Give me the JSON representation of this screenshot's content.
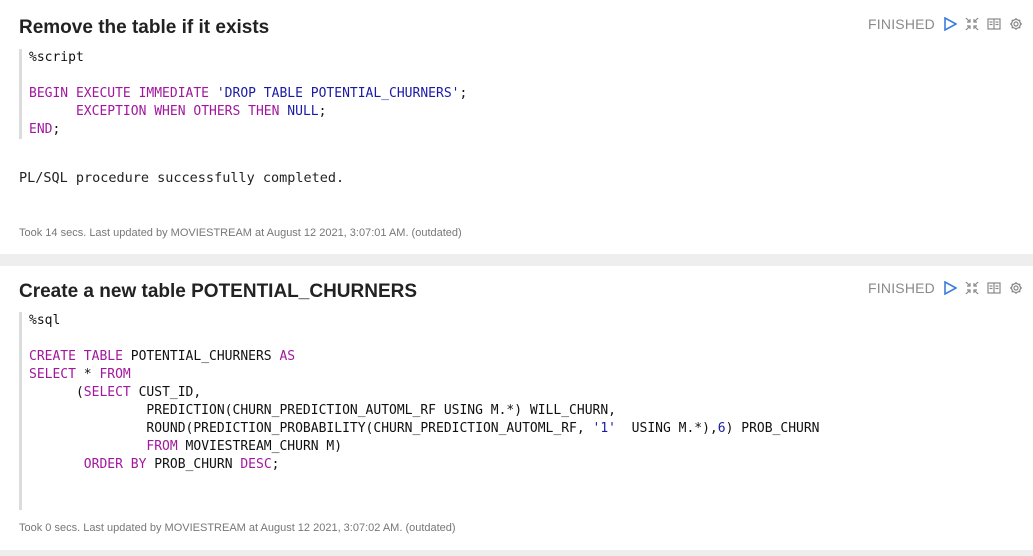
{
  "paragraph1": {
    "title": "Remove the table if it exists",
    "status": "FINISHED",
    "code_lines": [
      [
        {
          "t": "%script",
          "c": ""
        }
      ],
      [
        {
          "t": "",
          "c": ""
        }
      ],
      [
        {
          "t": "BEGIN EXECUTE IMMEDIATE",
          "c": "kw"
        },
        {
          "t": " ",
          "c": ""
        },
        {
          "t": "'DROP TABLE POTENTIAL_CHURNERS'",
          "c": "str"
        },
        {
          "t": ";",
          "c": ""
        }
      ],
      [
        {
          "t": "      ",
          "c": ""
        },
        {
          "t": "EXCEPTION WHEN OTHERS THEN",
          "c": "kw"
        },
        {
          "t": " ",
          "c": ""
        },
        {
          "t": "NULL",
          "c": "num"
        },
        {
          "t": ";",
          "c": ""
        }
      ],
      [
        {
          "t": "END",
          "c": "kw"
        },
        {
          "t": ";",
          "c": ""
        }
      ]
    ],
    "output": "PL/SQL procedure successfully completed.",
    "footer": "Took 14 secs. Last updated by MOVIESTREAM at August 12 2021, 3:07:01 AM. (outdated)"
  },
  "paragraph2": {
    "title": "Create a new table POTENTIAL_CHURNERS",
    "status": "FINISHED",
    "code_lines": [
      [
        {
          "t": "%sql",
          "c": ""
        }
      ],
      [
        {
          "t": "",
          "c": ""
        }
      ],
      [
        {
          "t": "CREATE TABLE",
          "c": "kw"
        },
        {
          "t": " POTENTIAL_CHURNERS ",
          "c": ""
        },
        {
          "t": "AS",
          "c": "kw"
        }
      ],
      [
        {
          "t": "SELECT",
          "c": "kw"
        },
        {
          "t": " * ",
          "c": ""
        },
        {
          "t": "FROM",
          "c": "kw"
        }
      ],
      [
        {
          "t": "      (",
          "c": ""
        },
        {
          "t": "SELECT",
          "c": "kw"
        },
        {
          "t": " CUST_ID,",
          "c": ""
        }
      ],
      [
        {
          "t": "               PREDICTION(CHURN_PREDICTION_AUTOML_RF USING M.*) WILL_CHURN,",
          "c": ""
        }
      ],
      [
        {
          "t": "               ROUND(PREDICTION_PROBABILITY(CHURN_PREDICTION_AUTOML_RF, ",
          "c": ""
        },
        {
          "t": "'1'",
          "c": "str"
        },
        {
          "t": "  USING M.*),",
          "c": ""
        },
        {
          "t": "6",
          "c": "num"
        },
        {
          "t": ") PROB_CHURN",
          "c": ""
        }
      ],
      [
        {
          "t": "               ",
          "c": ""
        },
        {
          "t": "FROM",
          "c": "kw"
        },
        {
          "t": " MOVIESTREAM_CHURN M)",
          "c": ""
        }
      ],
      [
        {
          "t": "       ",
          "c": ""
        },
        {
          "t": "ORDER BY",
          "c": "kw"
        },
        {
          "t": " PROB_CHURN ",
          "c": ""
        },
        {
          "t": "DESC",
          "c": "kw"
        },
        {
          "t": ";",
          "c": ""
        }
      ],
      [
        {
          "t": "",
          "c": ""
        }
      ],
      [
        {
          "t": "",
          "c": ""
        }
      ]
    ],
    "footer": "Took 0 secs. Last updated by MOVIESTREAM at August 12 2021, 3:07:02 AM. (outdated)"
  },
  "icons": [
    "run-icon",
    "collapse-icon",
    "book-icon",
    "gear-icon"
  ],
  "colors": {
    "keyword": "#a1179e",
    "string": "#1a1aa6",
    "run": "#3b7ddd"
  }
}
